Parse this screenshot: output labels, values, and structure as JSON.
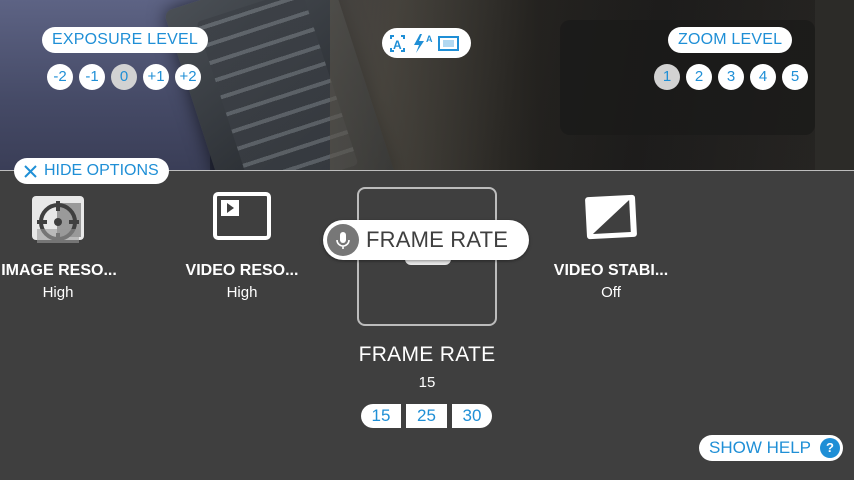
{
  "exposure": {
    "label": "EXPOSURE LEVEL",
    "levels": [
      "-2",
      "-1",
      "0",
      "+1",
      "+2"
    ],
    "selected": "0"
  },
  "mode_icons": [
    "auto-focus-icon",
    "auto-flash-icon",
    "aspect-ratio-icon"
  ],
  "zoom": {
    "label": "ZOOM LEVEL",
    "levels": [
      "1",
      "2",
      "3",
      "4",
      "5"
    ],
    "selected": "1"
  },
  "hide_options": "HIDE OPTIONS",
  "options": [
    {
      "name": "IMAGE RESO...",
      "value": "High",
      "icon": "image-resolution-icon"
    },
    {
      "name": "VIDEO RESO...",
      "value": "High",
      "icon": "video-resolution-icon"
    },
    {
      "name": "FRAME RATE",
      "value": "15",
      "icon": "frame-rate-icon"
    },
    {
      "name": "VIDEO STABI...",
      "value": "Off",
      "icon": "video-stabilization-icon"
    }
  ],
  "frame_rate": {
    "title": "FRAME RATE",
    "value": "15",
    "choices": [
      "15",
      "25",
      "30"
    ]
  },
  "voice_hint": {
    "label": "FRAME RATE",
    "icon": "microphone-icon"
  },
  "show_help": {
    "label": "SHOW HELP",
    "badge": "?"
  },
  "colors": {
    "accent": "#1f8fd6",
    "background": "#3f3f3f",
    "pill": "#ffffff"
  }
}
